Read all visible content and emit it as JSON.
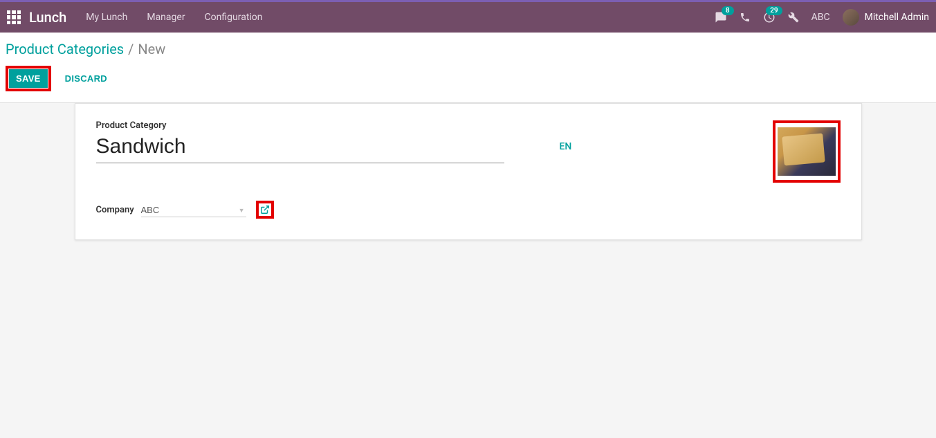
{
  "navbar": {
    "app_title": "Lunch",
    "menu": [
      {
        "label": "My Lunch"
      },
      {
        "label": "Manager"
      },
      {
        "label": "Configuration"
      }
    ],
    "messages_badge": "8",
    "activities_badge": "29",
    "company": "ABC",
    "user_name": "Mitchell Admin"
  },
  "breadcrumb": {
    "parent": "Product Categories",
    "current": "New"
  },
  "actions": {
    "save_label": "SAVE",
    "discard_label": "DISCARD"
  },
  "form": {
    "category_label": "Product Category",
    "category_value": "Sandwich",
    "lang": "EN",
    "company_label": "Company",
    "company_value": "ABC"
  }
}
